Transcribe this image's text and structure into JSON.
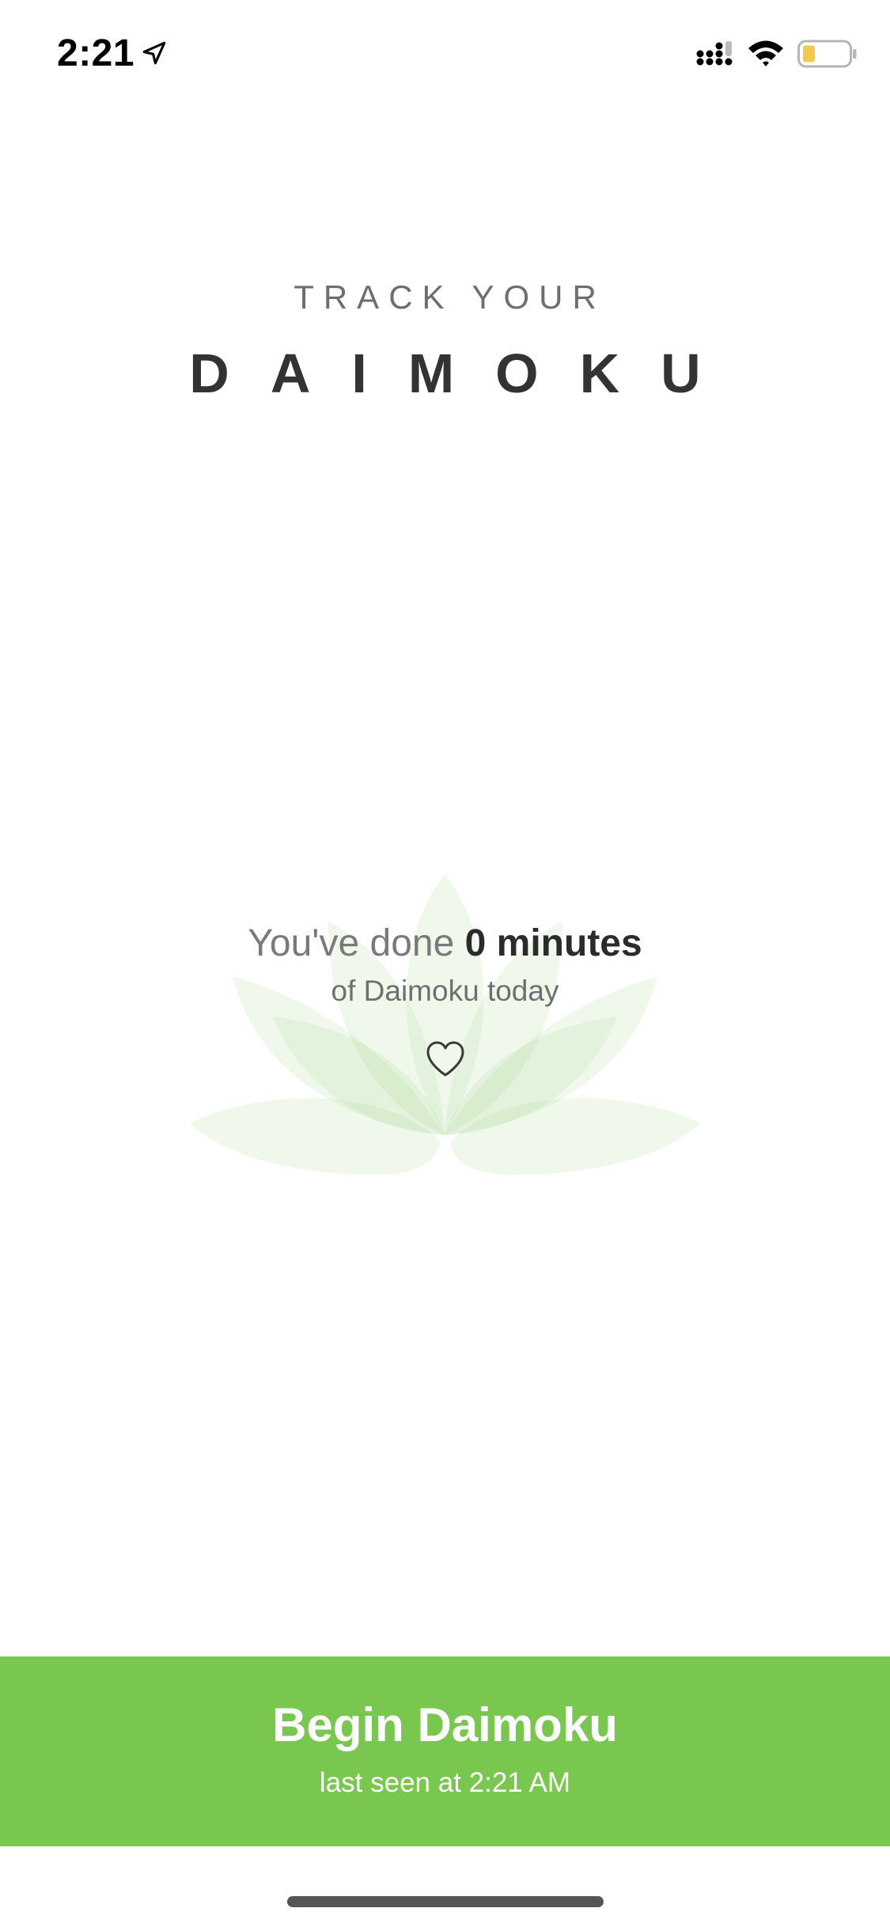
{
  "status_bar": {
    "time": "2:21",
    "icons": [
      "location-arrow-icon",
      "cellular-signal-icon",
      "wifi-icon",
      "battery-icon"
    ],
    "battery_color": "#f2c94c"
  },
  "header": {
    "subtitle": "TRACK YOUR",
    "title": "DAIMOKU"
  },
  "summary": {
    "prefix": "You've done",
    "minutes": "0 minutes",
    "suffix": "of Daimoku today",
    "icon": "heart-outline-icon"
  },
  "decoration": {
    "icon": "lotus-icon",
    "color": "#e8f5df"
  },
  "action": {
    "label": "Begin Daimoku",
    "sublabel": "last seen at 2:21 AM",
    "color": "#79c74f"
  }
}
